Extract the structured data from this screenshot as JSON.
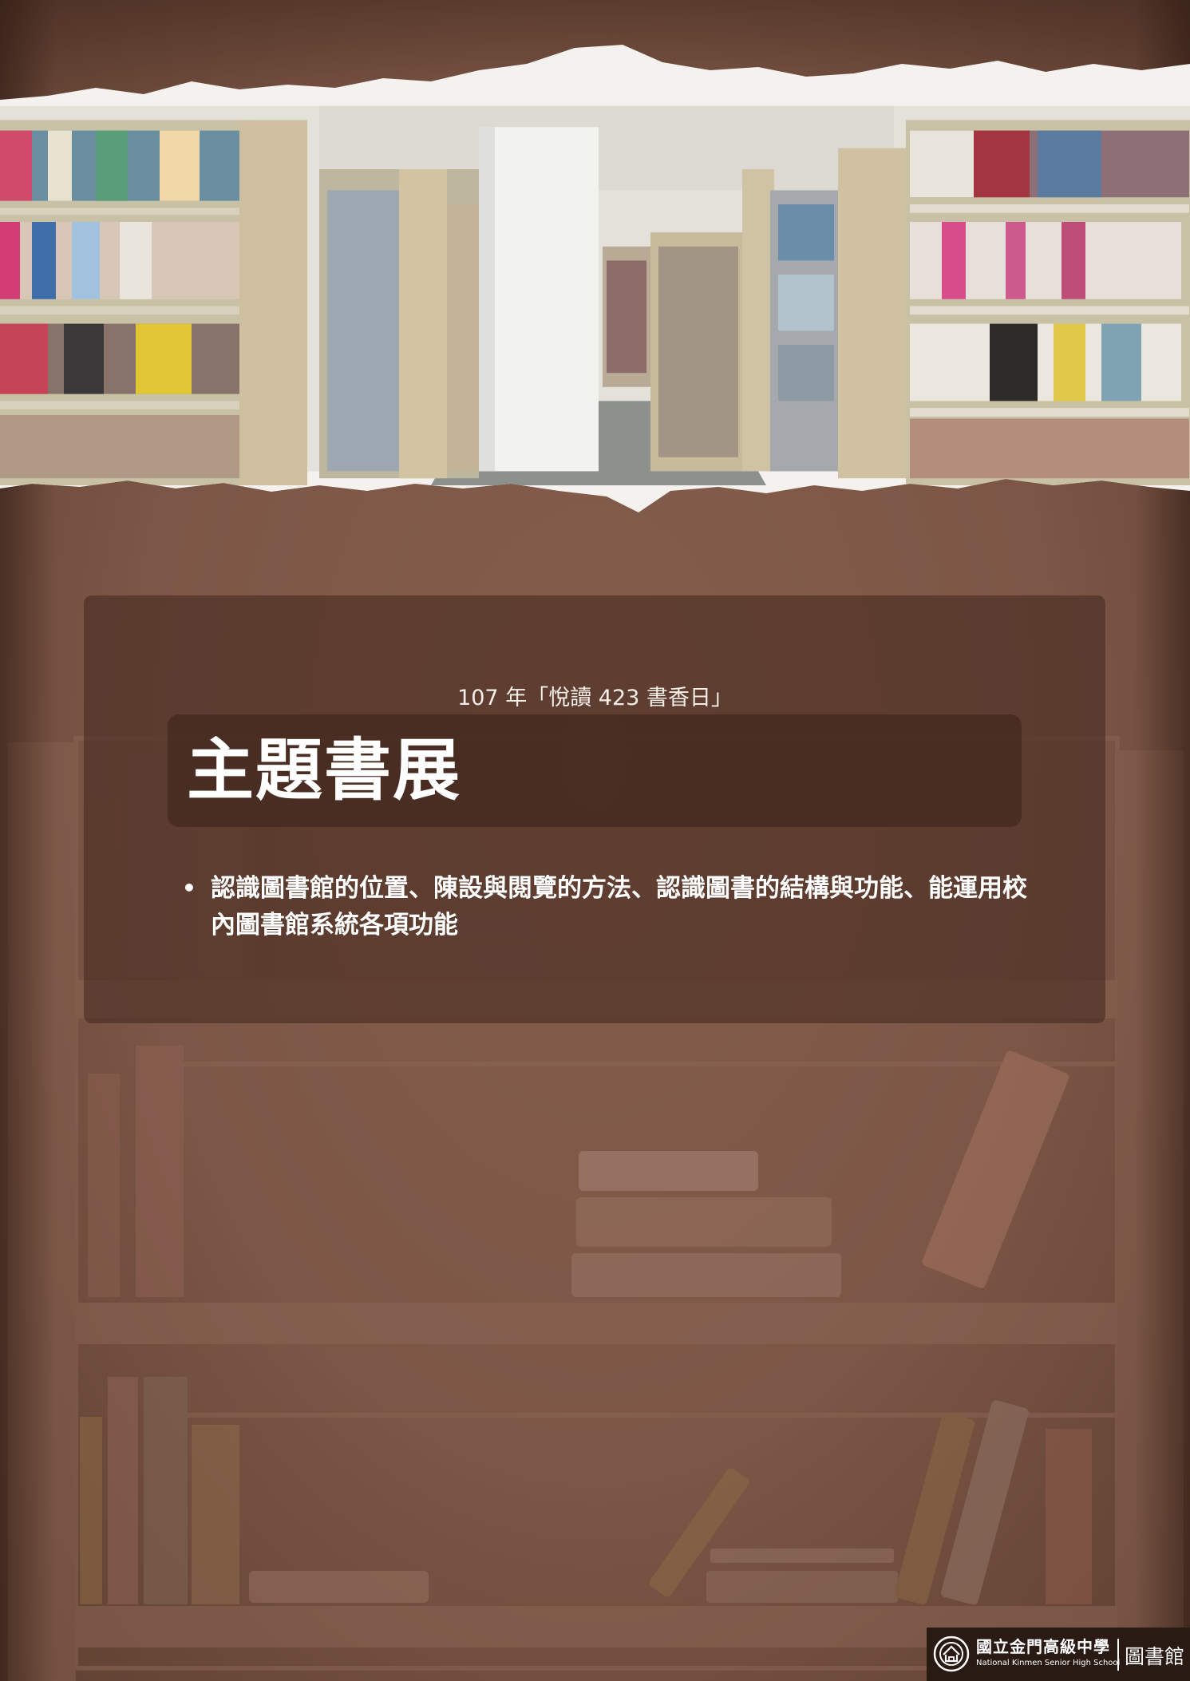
{
  "event": {
    "subtitle": "107 年「悅讀 423 書香日」"
  },
  "page": {
    "title": "主題書展"
  },
  "bullets": [
    "認識圖書館的位置、陳設與閱覽的方法、認識圖書的結構與功能、能運用校內圖書館系統各項功能"
  ],
  "footer": {
    "school_name_zh": "國立金門高級中學",
    "school_name_en": "National Kinmen Senior High School",
    "department": "圖書館"
  },
  "colors": {
    "background": "#7d5747",
    "card": "#4a2c22",
    "text": "#ffffff"
  },
  "images": {
    "banner": "library-bookshelves-photo",
    "background_art": "bookshelf-illustration"
  }
}
